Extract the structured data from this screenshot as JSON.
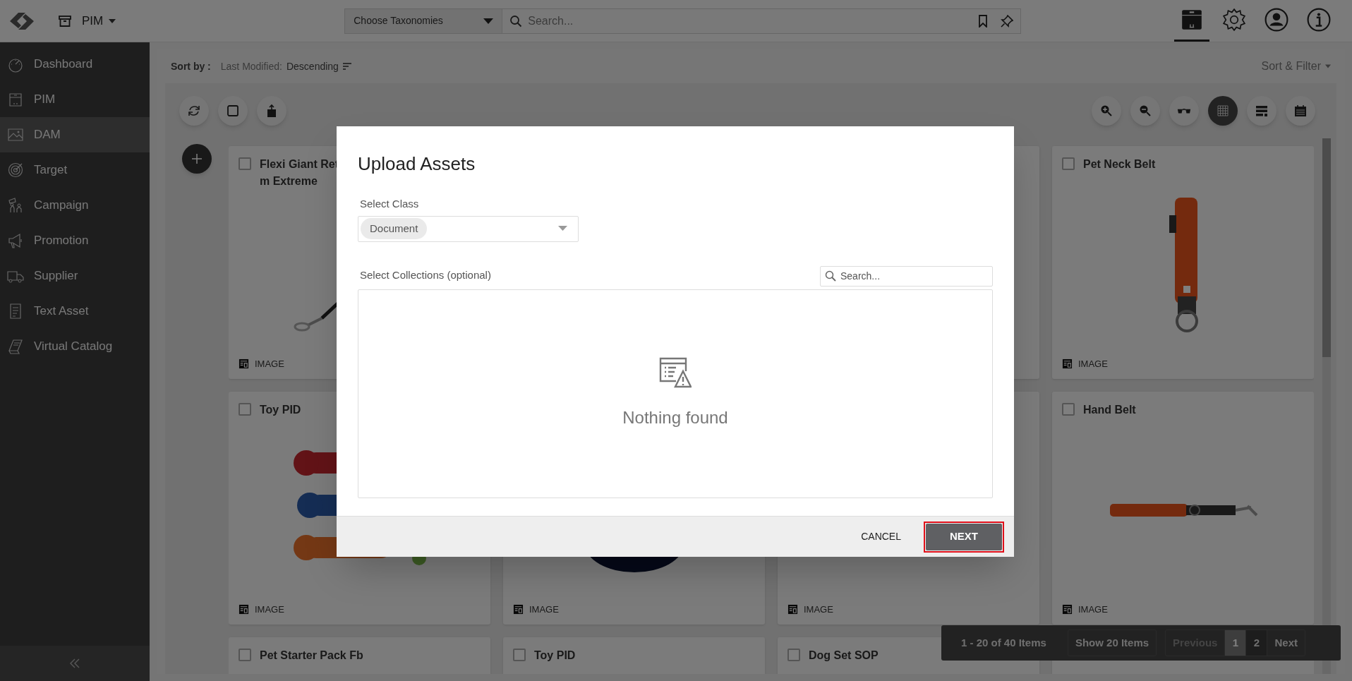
{
  "header": {
    "app_menu": "PIM",
    "taxonomy_select": "Choose Taxonomies",
    "search": {
      "placeholder": "Search..."
    },
    "tools": [
      {
        "kind": "box",
        "selected": true
      },
      {
        "kind": "gear",
        "selected": false
      },
      {
        "kind": "user",
        "selected": false
      },
      {
        "kind": "info",
        "selected": false
      }
    ]
  },
  "sidebar": {
    "items": [
      {
        "label": "Dashboard",
        "selected": false
      },
      {
        "label": "PIM",
        "selected": false
      },
      {
        "label": "DAM",
        "selected": true
      },
      {
        "label": "Target",
        "selected": false
      },
      {
        "label": "Campaign",
        "selected": false
      },
      {
        "label": "Promotion",
        "selected": false
      },
      {
        "label": "Supplier",
        "selected": false
      },
      {
        "label": "Text Asset",
        "selected": false
      },
      {
        "label": "Virtual Catalog",
        "selected": false
      }
    ]
  },
  "sort": {
    "label": "Sort by :",
    "field": "Last Modified:",
    "order": "Descending",
    "filter_toggle": "Sort & Filter"
  },
  "toolbar": {
    "right": [
      {
        "kind": "zoom-in",
        "selected": false
      },
      {
        "kind": "zoom-out",
        "selected": false
      },
      {
        "kind": "glasses",
        "selected": false
      },
      {
        "kind": "grid",
        "selected": true
      },
      {
        "kind": "list",
        "selected": false
      },
      {
        "kind": "calendar",
        "selected": false
      }
    ]
  },
  "cards": [
    {
      "kind": "asset",
      "title": "Flexi Giant Ret\nm Extreme",
      "checked": false,
      "type": "IMAGE"
    },
    {
      "kind": "hidden"
    },
    {
      "kind": "covered"
    },
    {
      "kind": "asset",
      "title": "Pet Neck Belt",
      "checked": false,
      "type": "IMAGE"
    },
    {
      "kind": "asset",
      "title": "Toy PID",
      "checked": false,
      "type": "IMAGE"
    },
    {
      "kind": "asset",
      "type": "IMAGE"
    },
    {
      "kind": "asset",
      "type": "IMAGE"
    },
    {
      "kind": "asset",
      "title": "Hand Belt",
      "checked": false,
      "type": "IMAGE"
    },
    {
      "kind": "asset",
      "title": "Pet Starter Pack Fb",
      "checked": false
    },
    {
      "kind": "asset",
      "title": "Toy PID",
      "checked": false
    },
    {
      "kind": "asset",
      "title": "Dog Set SOP",
      "checked": false
    },
    {
      "kind": "covered"
    }
  ],
  "pagination": {
    "summary": "1 - 20 of 40 Items",
    "page_size": "Show 20 Items",
    "previous": {
      "label": "Previous",
      "disabled": true
    },
    "pages": [
      {
        "label": "1",
        "selected": true
      },
      {
        "label": "2",
        "selected": false
      }
    ],
    "next": {
      "label": "Next",
      "disabled": false
    }
  },
  "dialog": {
    "title": "Upload Assets",
    "class_label": "Select Class",
    "class_value": "Document",
    "collections_label": "Select Collections (optional)",
    "collections_search": {
      "placeholder": "Search..."
    },
    "empty_text": "Nothing found",
    "buttons": [
      {
        "label": "CANCEL",
        "kind": "text"
      },
      {
        "label": "NEXT",
        "kind": "primary"
      }
    ]
  }
}
